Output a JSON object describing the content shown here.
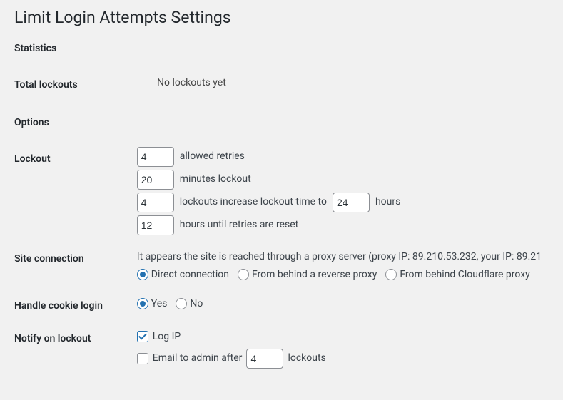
{
  "page_title": "Limit Login Attempts Settings",
  "statistics": {
    "heading": "Statistics",
    "total_lockouts_label": "Total lockouts",
    "total_lockouts_value": "No lockouts yet"
  },
  "options": {
    "heading": "Options",
    "lockout": {
      "label": "Lockout",
      "allowed_retries_value": "4",
      "allowed_retries_text": "allowed retries",
      "minutes_lockout_value": "20",
      "minutes_lockout_text": "minutes lockout",
      "lockouts_increase_value": "4",
      "lockouts_increase_text": "lockouts increase lockout time to",
      "lockouts_increase_hours_value": "24",
      "hours_text": "hours",
      "hours_until_reset_value": "12",
      "hours_until_reset_text": "hours until retries are reset"
    },
    "site_connection": {
      "label": "Site connection",
      "proxy_note": "It appears the site is reached through a proxy server (proxy IP: 89.210.53.232, your IP: 89.21",
      "direct_label": "Direct connection",
      "reverse_proxy_label": "From behind a reverse proxy",
      "cloudflare_label": "From behind Cloudflare proxy"
    },
    "cookie_login": {
      "label": "Handle cookie login",
      "yes": "Yes",
      "no": "No"
    },
    "notify": {
      "label": "Notify on lockout",
      "log_ip": "Log IP",
      "email_admin_prefix": "Email to admin after",
      "email_admin_value": "4",
      "email_admin_suffix": "lockouts"
    }
  }
}
